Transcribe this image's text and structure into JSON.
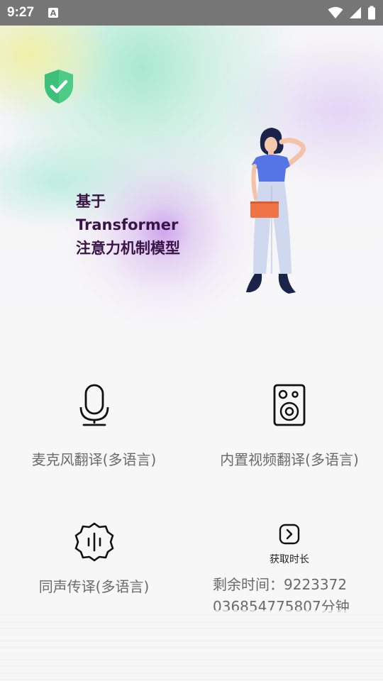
{
  "status_bar": {
    "time": "9:27",
    "notification_icon": "A"
  },
  "hero": {
    "line1": "基于",
    "line2": "Transformer",
    "line3": "注意力机制模型"
  },
  "features": {
    "mic": {
      "label": "麦克风翻译(多语言)",
      "icon": "microphone-icon"
    },
    "video": {
      "label": "内置视频翻译(多语言)",
      "icon": "speaker-icon"
    },
    "sync": {
      "label": "同声传译(多语言)",
      "icon": "soundwave-badge-icon"
    }
  },
  "duration": {
    "button_label": "获取时长",
    "remaining_text": "剩余时间：9223372036854775807分钟"
  },
  "colors": {
    "status_bar": "#767676",
    "hero_text": "#3a1446",
    "label_text": "#6a6a6a"
  }
}
